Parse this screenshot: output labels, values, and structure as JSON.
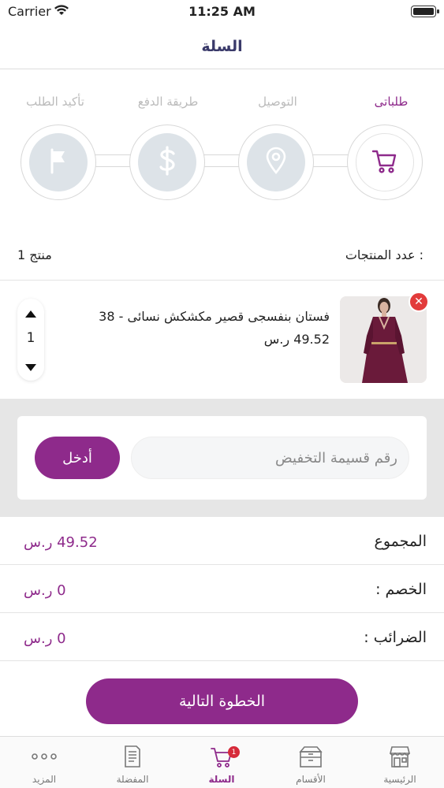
{
  "status_bar": {
    "carrier": "Carrier",
    "time": "11:25 AM"
  },
  "nav": {
    "title": "السلة"
  },
  "steps": [
    {
      "label": "طلباتى",
      "icon": "cart-icon",
      "active": true
    },
    {
      "label": "التوصيل",
      "icon": "location-pin-icon",
      "active": false
    },
    {
      "label": "طريقة الدفع",
      "icon": "dollar-icon",
      "active": false
    },
    {
      "label": "تأكيد الطلب",
      "icon": "flag-icon",
      "active": false
    }
  ],
  "product_count": {
    "label": "عدد المنتجات :",
    "value": "1 منتج"
  },
  "product": {
    "name": "فستان بنفسجى قصير مكشكش نسائى - 38",
    "price": "49.52 ر.س",
    "quantity": "1"
  },
  "coupon": {
    "placeholder": "رقم قسيمة التخفيض",
    "apply_label": "أدخل"
  },
  "totals": [
    {
      "label": "المجموع",
      "value": "49.52 ر.س"
    },
    {
      "label": "الخصم :",
      "value": "0 ر.س"
    },
    {
      "label": "الضرائب :",
      "value": "0 ر.س"
    }
  ],
  "next_label": "الخطوة التالية",
  "tabs": [
    {
      "label": "الرئيسية",
      "icon": "store-icon"
    },
    {
      "label": "الأقسام",
      "icon": "box-icon"
    },
    {
      "label": "السلة",
      "icon": "cart-icon",
      "badge": "1",
      "active": true
    },
    {
      "label": "المفضلة",
      "icon": "document-icon"
    },
    {
      "label": "المزيد",
      "icon": "more-dots-icon"
    }
  ],
  "colors": {
    "accent": "#8e2a8b",
    "title": "#3a3a6a",
    "badge": "#d62a3a",
    "remove": "#e23b3b"
  }
}
